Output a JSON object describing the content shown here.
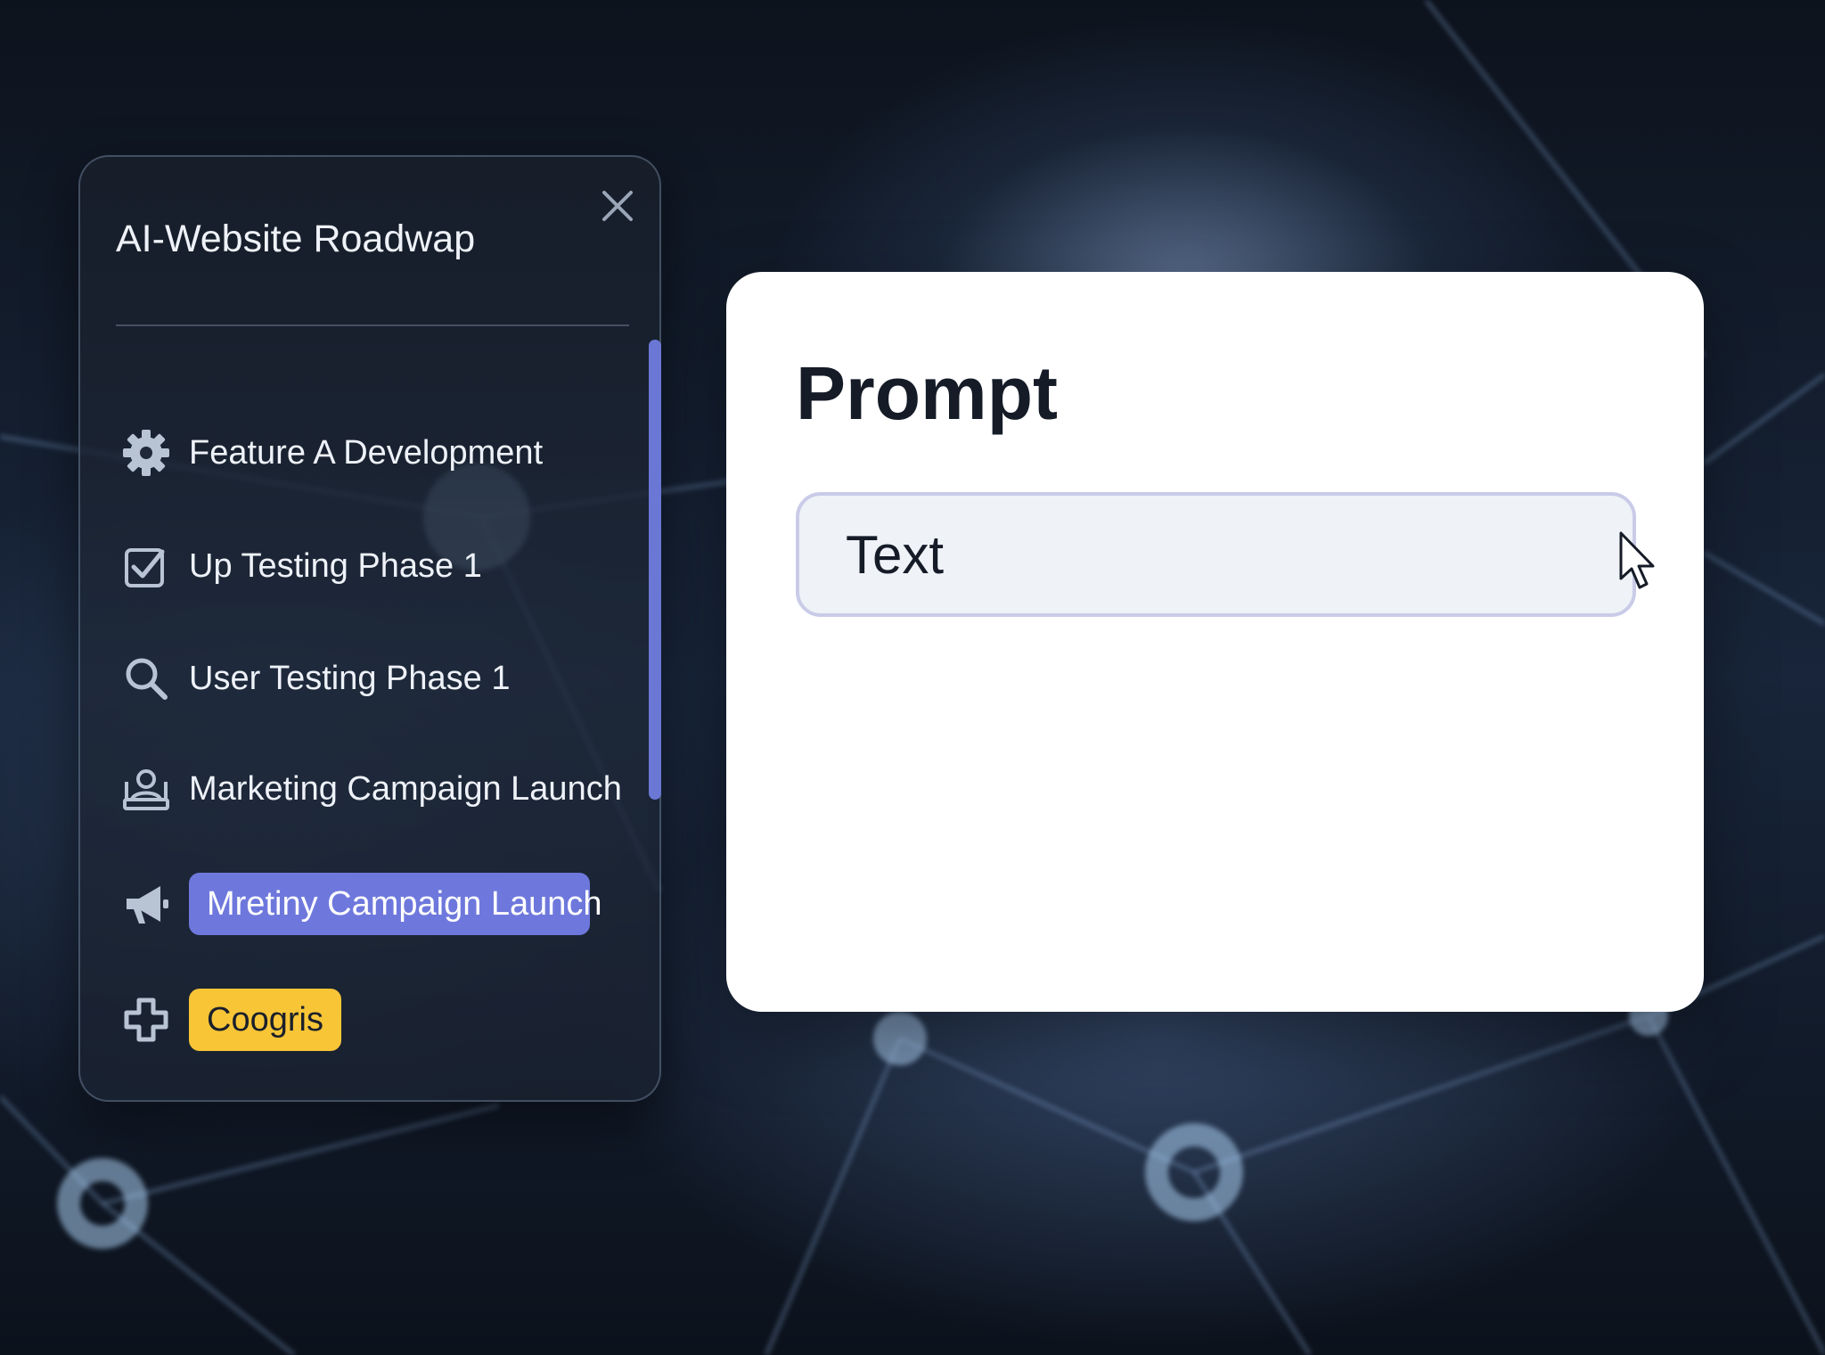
{
  "roadmap_panel": {
    "title": "AI-Website Roadwap",
    "close_icon": "close-icon",
    "items": [
      {
        "label": "Feature A Development",
        "icon": "gear-icon",
        "style": "plain"
      },
      {
        "label": "Up Testing Phase 1",
        "icon": "checkbox-icon",
        "style": "plain"
      },
      {
        "label": "User Testing Phase 1",
        "icon": "search-icon",
        "style": "plain"
      },
      {
        "label": "Marketing Campaign Launch",
        "icon": "presenter-icon",
        "style": "plain"
      },
      {
        "label": "Mretiny Campaign Launch",
        "icon": "megaphone-icon",
        "style": "highlight-blue"
      },
      {
        "label": "Coogris",
        "icon": "plus-outline-icon",
        "style": "badge-yellow"
      }
    ]
  },
  "prompt_card": {
    "title": "Prompt",
    "input": {
      "value": "",
      "placeholder": "Text"
    },
    "cursor_icon": "mouse-pointer-icon"
  },
  "colors": {
    "accent_blue": "#6e78dc",
    "badge_yellow": "#f7c536",
    "panel_bg": "#1e2838",
    "card_bg": "#ffffff",
    "input_border": "#c9cbe8"
  }
}
